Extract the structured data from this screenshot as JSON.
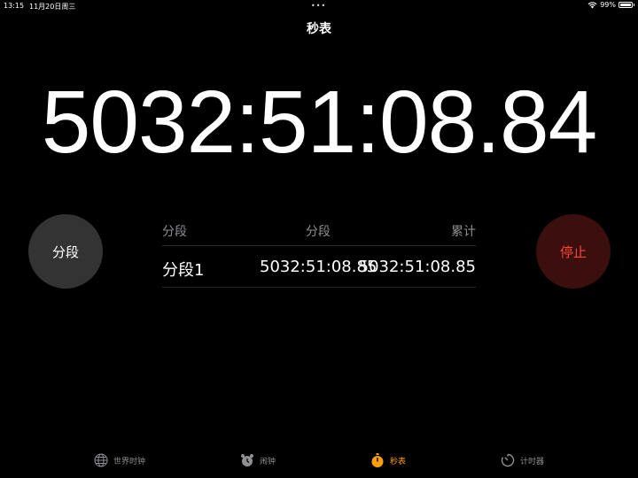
{
  "status": {
    "time": "13:15",
    "date": "11月20日周三",
    "dots": "•••",
    "battery": "99%"
  },
  "nav": {
    "title": "秒表"
  },
  "stopwatch": {
    "elapsed": "5032:51:08.84"
  },
  "buttons": {
    "lap": "分段",
    "stop": "停止"
  },
  "laps": {
    "headers": [
      "分段",
      "分段",
      "累计"
    ],
    "rows": [
      {
        "name": "分段1",
        "lap": "5032:51:08.85",
        "total": "5032:51:08.85"
      }
    ]
  },
  "tabs": [
    {
      "label": "世界时钟",
      "icon": "globe-icon"
    },
    {
      "label": "闹钟",
      "icon": "alarm-clock-icon"
    },
    {
      "label": "秒表",
      "icon": "stopwatch-icon",
      "active": true
    },
    {
      "label": "计时器",
      "icon": "timer-icon"
    }
  ],
  "colors": {
    "accent": "#ff9f0a",
    "stop_text": "#ff453a",
    "stop_bg": "#3a0f0d",
    "lap_bg": "#333333",
    "muted": "#8e8e93"
  }
}
